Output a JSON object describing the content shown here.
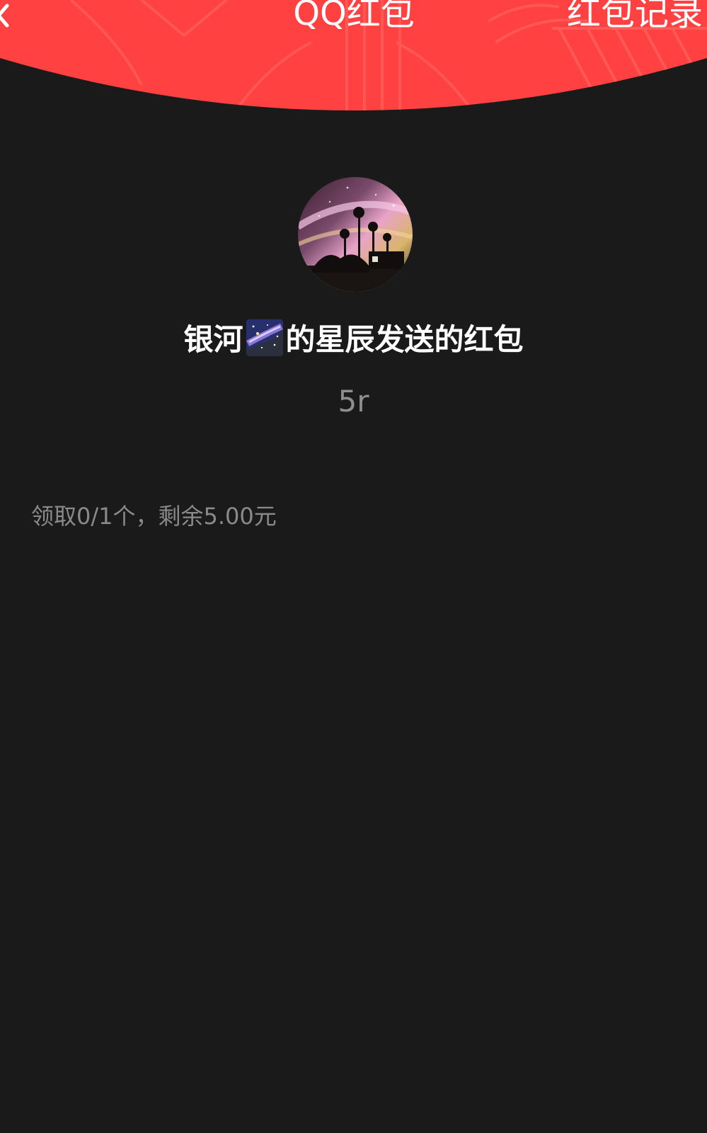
{
  "header": {
    "title": "QQ红包",
    "records_label": "红包记录",
    "background_color": "#ff4141"
  },
  "back_icon": "chevron-left-icon",
  "sender": {
    "name_part1": "银河",
    "emoji": "milky-way-emoji",
    "name_part2": "的星辰发送的红包",
    "avatar_icon": "sender-avatar"
  },
  "message": "5r",
  "summary": "领取0/1个，剩余5.00元",
  "colors": {
    "background": "#1a1a1a",
    "accent_red": "#ff4141",
    "secondary_text": "#8e8e8e"
  }
}
